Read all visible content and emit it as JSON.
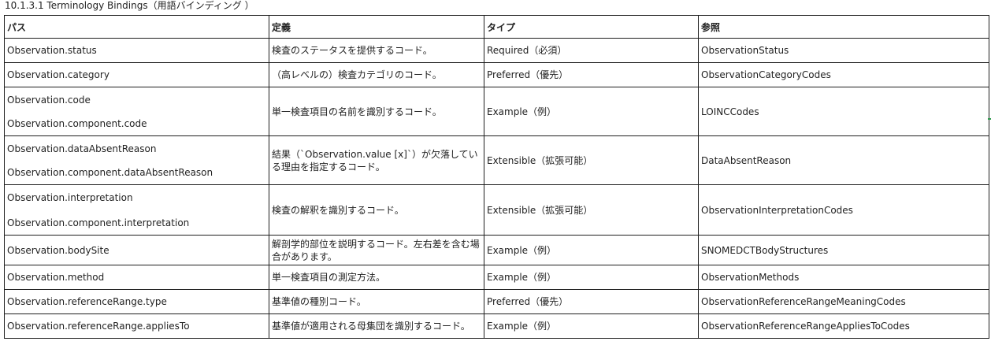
{
  "caption": "10.1.3.1 Terminology Bindings（用語バインディング ）",
  "headers": {
    "path": "パス",
    "definition": "定義",
    "type": "タイプ",
    "reference": "参照"
  },
  "rows": [
    {
      "paths": [
        "Observation.status"
      ],
      "definition": "検査のステータスを提供するコード。",
      "type": "Required（必須）",
      "reference": "ObservationStatus"
    },
    {
      "paths": [
        "Observation.category"
      ],
      "definition": "（高レベルの）検査カテゴリのコード。",
      "type": "Preferred（優先）",
      "reference": "ObservationCategoryCodes"
    },
    {
      "paths": [
        "Observation.code",
        "Observation.component.code"
      ],
      "definition": "単一検査項目の名前を識別するコード。",
      "type": "Example（例）",
      "reference": "LOINCCodes"
    },
    {
      "paths": [
        "Observation.dataAbsentReason",
        "Observation.component.dataAbsentReason"
      ],
      "definition": "結果（`Observation.value [x]`）が欠落している理由を指定するコード。",
      "type": "Extensible（拡張可能）",
      "reference": "DataAbsentReason"
    },
    {
      "paths": [
        "Observation.interpretation",
        "Observation.component.interpretation"
      ],
      "definition": "検査の解釈を識別するコード。",
      "type": "Extensible（拡張可能）",
      "reference": "ObservationInterpretationCodes"
    },
    {
      "paths": [
        "Observation.bodySite"
      ],
      "definition": "解剖学的部位を説明するコード。左右差を含む場合があります。",
      "type": "Example（例）",
      "reference": "SNOMEDCTBodyStructures"
    },
    {
      "paths": [
        "Observation.method"
      ],
      "definition": "単一検査項目の測定方法。",
      "type": "Example（例）",
      "reference": "ObservationMethods"
    },
    {
      "paths": [
        "Observation.referenceRange.type"
      ],
      "definition": "基準値の種別コード。",
      "type": "Preferred（優先）",
      "reference": "ObservationReferenceRangeMeaningCodes"
    },
    {
      "paths": [
        "Observation.referenceRange.appliesTo"
      ],
      "definition": "基準値が適用される母集団を識別するコード。",
      "type": "Example（例）",
      "reference": "ObservationReferenceRangeAppliesToCodes"
    }
  ]
}
